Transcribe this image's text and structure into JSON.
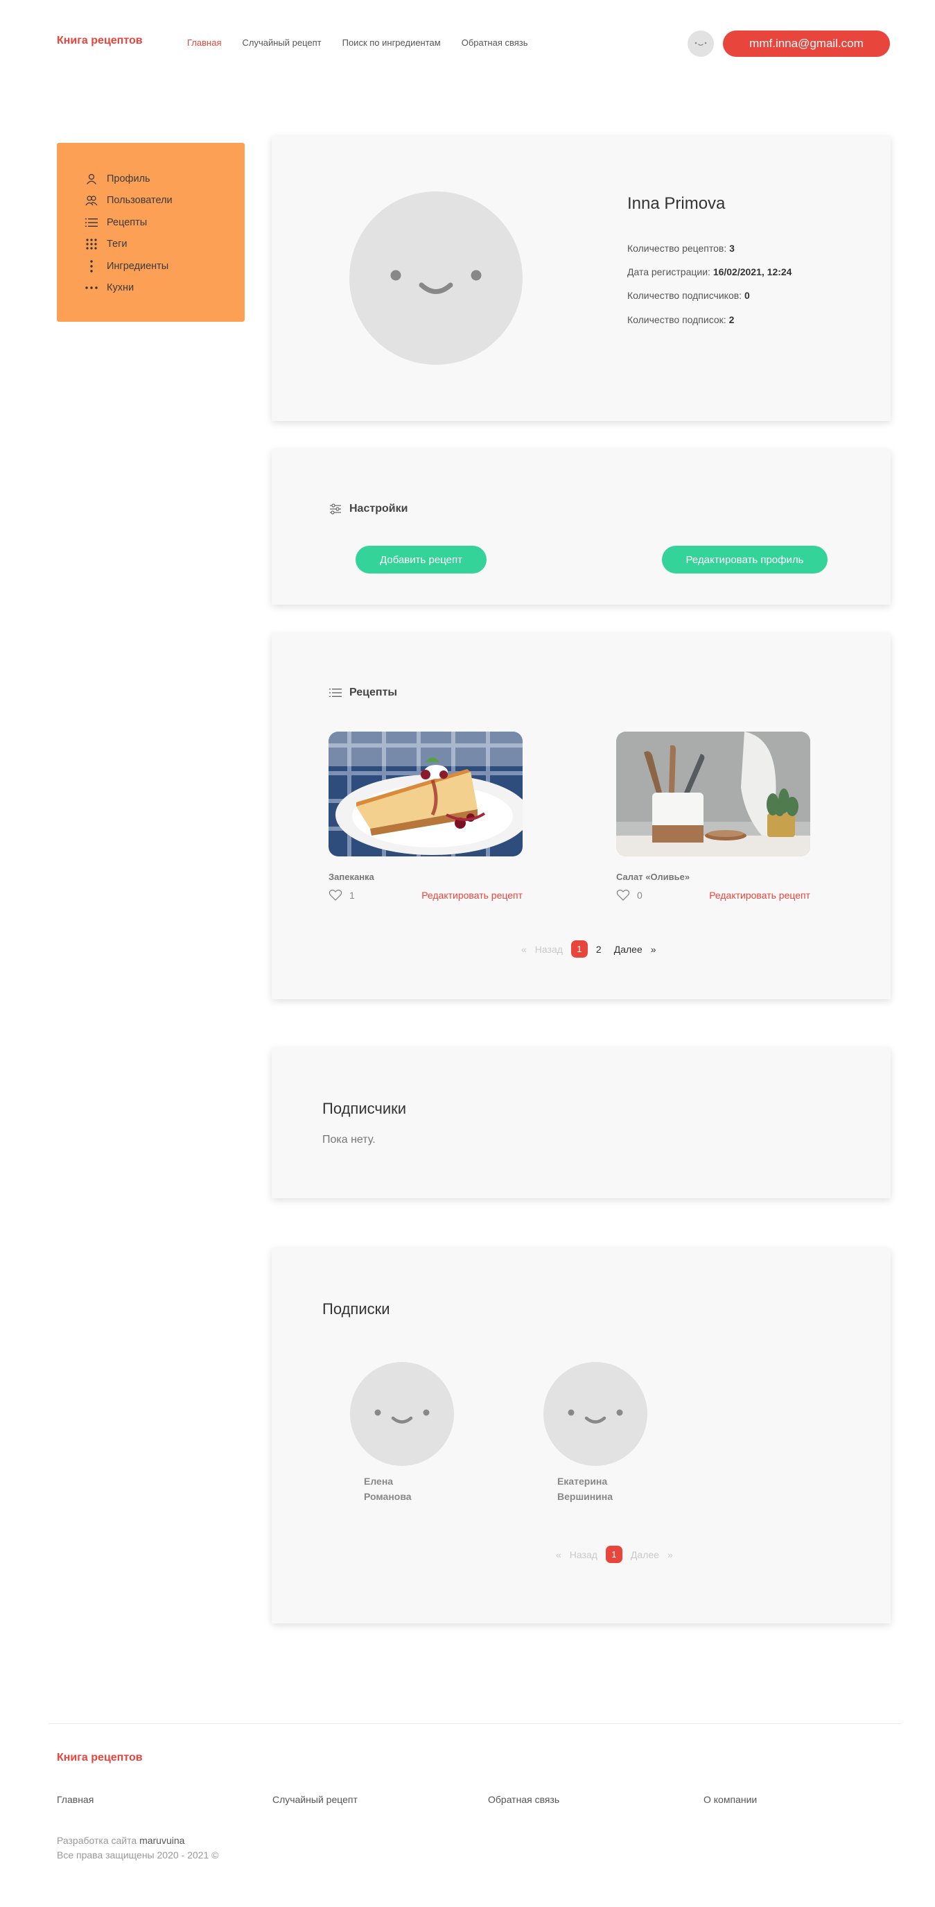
{
  "header": {
    "brand": "Книга рецептов",
    "nav": [
      "Главная",
      "Случайный рецепт",
      "Поиск по ингредиентам",
      "Обратная связь"
    ],
    "email": "mmf.inna@gmail.com"
  },
  "sidebar": {
    "items": [
      "Профиль",
      "Пользователи",
      "Рецепты",
      "Теги",
      "Ингредиенты",
      "Кухни"
    ]
  },
  "profile": {
    "name": "Inna Primova",
    "stats": [
      {
        "label": "Количество рецептов: ",
        "value": "3"
      },
      {
        "label": "Дата регистрации: ",
        "value": "16/02/2021, 12:24"
      },
      {
        "label": "Количество подписчиков: ",
        "value": "0"
      },
      {
        "label": "Количество подписок: ",
        "value": "2"
      }
    ]
  },
  "settings": {
    "title": "Настройки",
    "add_recipe": "Добавить рецепт",
    "edit_profile": "Редактировать профиль"
  },
  "recipes": {
    "title": "Рецепты",
    "items": [
      {
        "title": "Запеканка",
        "likes": "1",
        "edit": "Редактировать рецепт"
      },
      {
        "title": "Салат «Оливье»",
        "likes": "0",
        "edit": "Редактировать рецепт"
      }
    ],
    "pager": {
      "prev_arrow": "«",
      "prev": "Назад",
      "pages": [
        "1",
        "2"
      ],
      "next": "Далее",
      "next_arrow": "»"
    }
  },
  "subscribers": {
    "title": "Подписчики",
    "empty": "Пока нету."
  },
  "subscriptions": {
    "title": "Подписки",
    "users": [
      {
        "first": "Елена",
        "last": "Романова"
      },
      {
        "first": "Екатерина",
        "last": "Вершинина"
      }
    ],
    "pager": {
      "prev_arrow": "«",
      "prev": "Назад",
      "pages": [
        "1"
      ],
      "next": "Далее",
      "next_arrow": "»"
    }
  },
  "footer": {
    "brand": "Книга рецептов",
    "links": [
      "Главная",
      "Случайный рецепт",
      "Обратная связь",
      "О компании"
    ],
    "dev_prefix": "Разработка сайта ",
    "dev_name": "maruvuina",
    "rights": "Все права защищены 2020 - 2021 ©"
  },
  "colors": {
    "accent": "#e8453c",
    "sidebar": "#fba054",
    "button": "#34d399",
    "card": "#f8f8f8"
  }
}
